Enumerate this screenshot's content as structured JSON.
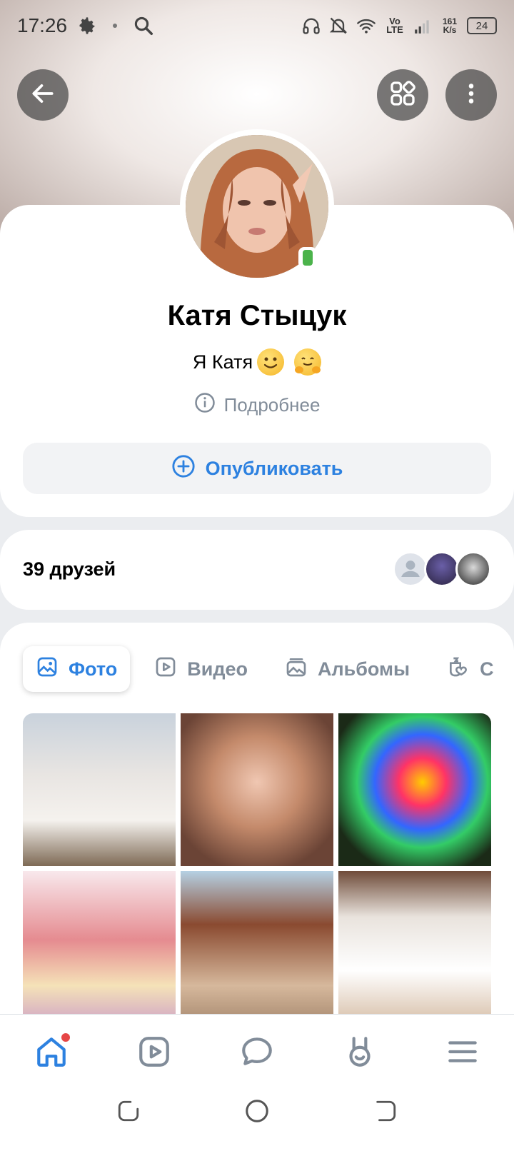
{
  "status_bar": {
    "time": "17:26",
    "network": "Vo LTE",
    "speed_top": "161",
    "speed_bottom": "K/s",
    "battery": "24"
  },
  "profile": {
    "name": "Катя Стыцук",
    "status": "Я Катя",
    "more_label": "Подробнее",
    "publish_label": "Опубликовать"
  },
  "friends": {
    "label": "39 друзей"
  },
  "tabs": [
    {
      "label": "Фото"
    },
    {
      "label": "Видео"
    },
    {
      "label": "Альбомы"
    },
    {
      "label": "С"
    }
  ],
  "colors": {
    "accent": "#2d81e0",
    "secondary_text": "#818c99",
    "online": "#4bb34b",
    "notification": "#e64646"
  },
  "icons": {
    "back": "arrow-left-icon",
    "services": "services-icon",
    "menu": "more-vertical-icon",
    "info": "info-icon",
    "publish": "plus-circle-icon",
    "nav": [
      "home-icon",
      "video-icon",
      "messages-icon",
      "clips-icon",
      "menu-icon"
    ]
  }
}
